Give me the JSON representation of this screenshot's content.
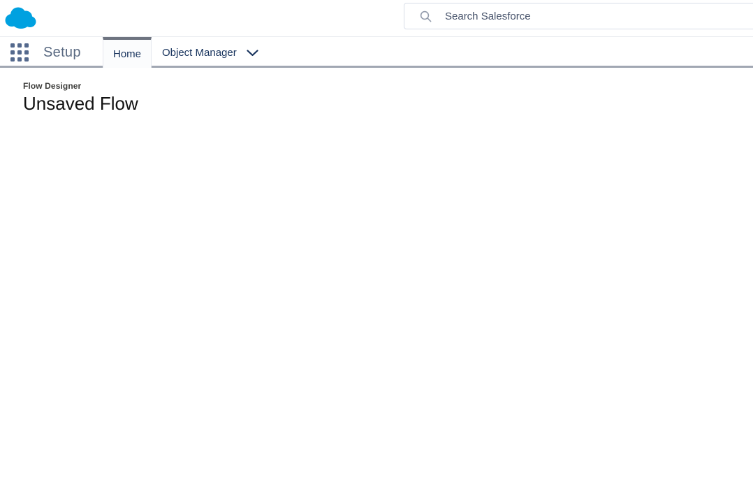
{
  "global_header": {
    "logo_name": "salesforce-cloud-logo",
    "search": {
      "placeholder": "Search Salesforce",
      "value": ""
    }
  },
  "setup_nav": {
    "title": "Setup",
    "tabs": [
      {
        "label": "Home",
        "active": true,
        "has_menu": false
      },
      {
        "label": "Object Manager",
        "active": false,
        "has_menu": true
      }
    ]
  },
  "content": {
    "eyebrow": "Flow Designer",
    "title": "Unsaved Flow"
  },
  "icons": {
    "app_launcher": "waffle-grid-icon",
    "search": "magnifier-icon",
    "object_manager_menu": "chevron-down-icon"
  },
  "colors": {
    "brand_blue": "#00a1e0",
    "nav_text": "#16325c",
    "waffle_dots": "#54698d",
    "setup_title_text": "#596981",
    "active_tab_accent": "#6e7480",
    "active_tab_bg": "#fbfcfd",
    "tab_bar_underline": "#a1a7b3",
    "header_separator": "#e7eaef",
    "search_border": "#d9dee8",
    "search_icon": "#939bab",
    "placeholder_text": "#47536b",
    "eyebrow_text": "#3e3e3c",
    "title_text": "#121212"
  }
}
